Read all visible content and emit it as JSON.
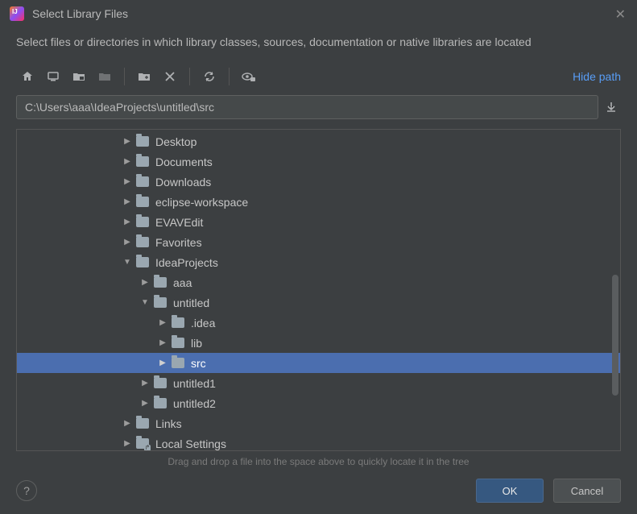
{
  "title": "Select Library Files",
  "subtitle": "Select files or directories in which library classes, sources, documentation or native libraries are located",
  "hide_path_label": "Hide path",
  "path_value": "C:\\Users\\aaa\\IdeaProjects\\untitled\\src",
  "hint": "Drag and drop a file into the space above to quickly locate it in the tree",
  "buttons": {
    "ok": "OK",
    "cancel": "Cancel"
  },
  "tree": [
    {
      "label": "Desktop",
      "indent": 3,
      "arrow": "right",
      "selected": false,
      "shortcut": false
    },
    {
      "label": "Documents",
      "indent": 3,
      "arrow": "right",
      "selected": false,
      "shortcut": false
    },
    {
      "label": "Downloads",
      "indent": 3,
      "arrow": "right",
      "selected": false,
      "shortcut": false
    },
    {
      "label": "eclipse-workspace",
      "indent": 3,
      "arrow": "right",
      "selected": false,
      "shortcut": false
    },
    {
      "label": "EVAVEdit",
      "indent": 3,
      "arrow": "right",
      "selected": false,
      "shortcut": false
    },
    {
      "label": "Favorites",
      "indent": 3,
      "arrow": "right",
      "selected": false,
      "shortcut": false
    },
    {
      "label": "IdeaProjects",
      "indent": 3,
      "arrow": "down",
      "selected": false,
      "shortcut": false
    },
    {
      "label": "aaa",
      "indent": 4,
      "arrow": "right",
      "selected": false,
      "shortcut": false
    },
    {
      "label": "untitled",
      "indent": 4,
      "arrow": "down",
      "selected": false,
      "shortcut": false
    },
    {
      "label": ".idea",
      "indent": 5,
      "arrow": "right",
      "selected": false,
      "shortcut": false
    },
    {
      "label": "lib",
      "indent": 5,
      "arrow": "right",
      "selected": false,
      "shortcut": false
    },
    {
      "label": "src",
      "indent": 5,
      "arrow": "right",
      "selected": true,
      "shortcut": false
    },
    {
      "label": "untitled1",
      "indent": 4,
      "arrow": "right",
      "selected": false,
      "shortcut": false
    },
    {
      "label": "untitled2",
      "indent": 4,
      "arrow": "right",
      "selected": false,
      "shortcut": false
    },
    {
      "label": "Links",
      "indent": 3,
      "arrow": "right",
      "selected": false,
      "shortcut": false
    },
    {
      "label": "Local Settings",
      "indent": 3,
      "arrow": "right",
      "selected": false,
      "shortcut": true
    }
  ]
}
